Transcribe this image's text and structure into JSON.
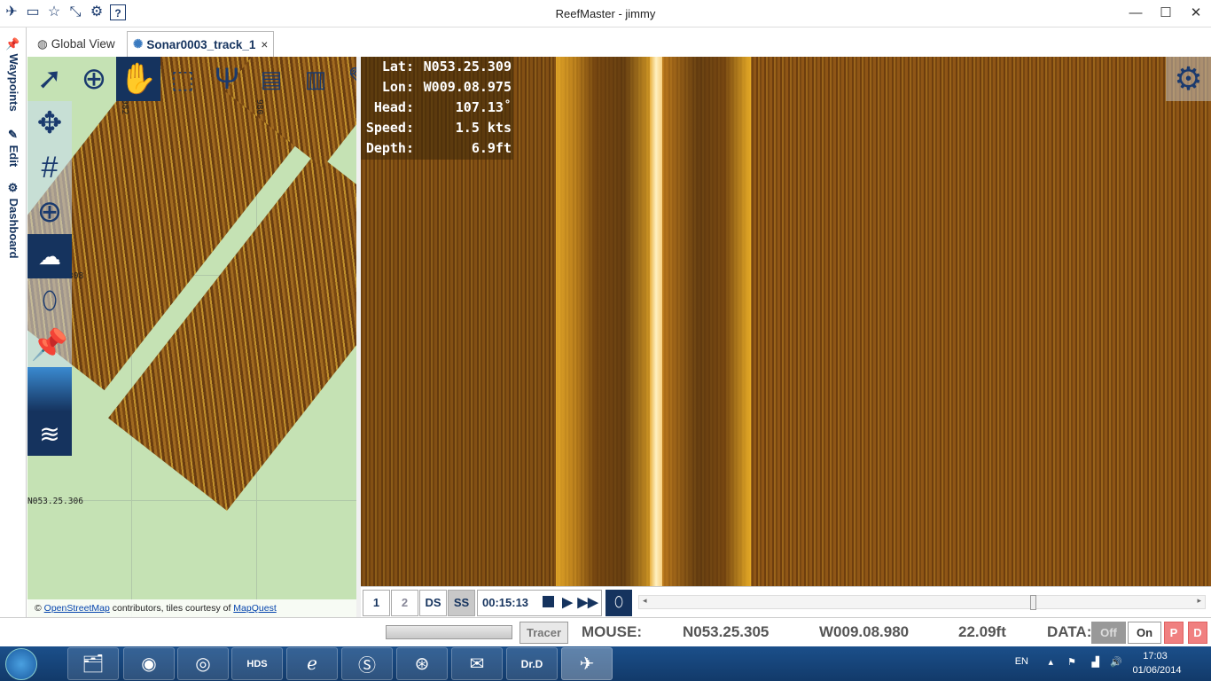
{
  "app": {
    "title": "ReefMaster - jimmy"
  },
  "window_controls": {
    "minimize": "—",
    "maximize": "☐",
    "close": "✕"
  },
  "quick_icons": [
    "reefmaster-logo-icon",
    "folder-icon",
    "star-icon",
    "collapse-icon",
    "gear-icon",
    "help-icon"
  ],
  "tabs": [
    {
      "label": "Global View",
      "icon": "globe-icon"
    },
    {
      "label": "Sonar0003_track_1",
      "icon": "spinner-icon",
      "close": "×"
    }
  ],
  "side_tabs": [
    {
      "label": "Waypoints",
      "icon": "pin-icon"
    },
    {
      "label": "Edit",
      "icon": "pencil-icon"
    },
    {
      "label": "Dashboard",
      "icon": "gear-icon"
    }
  ],
  "map": {
    "labels": {
      "lon_top1": "982",
      "lon_top2": "980",
      "lat_mid": "308",
      "lat_bottom": "N053.25.306"
    },
    "attribution": {
      "prefix": "©",
      "osm": "OpenStreetMap",
      "middle": "contributors, tiles courtesy of",
      "mq": "MapQuest"
    }
  },
  "hud": {
    "lat_label": "Lat:",
    "lat": "N053.25.309",
    "lon_label": "Lon:",
    "lon": "W009.08.975",
    "head_label": "Head:",
    "head": "107.13˚",
    "speed_label": "Speed:",
    "speed": "1.5 kts",
    "depth_label": "Depth:",
    "depth": "6.9ft"
  },
  "playback": {
    "btn1": "1",
    "btn2": "2",
    "ds": "DS",
    "ss": "SS",
    "time": "00:15:13",
    "slider_position": 0.7
  },
  "status": {
    "tracer": "Tracer",
    "mouse_label": "MOUSE:",
    "mouse_lat": "N053.25.305",
    "mouse_lon": "W009.08.980",
    "mouse_depth": "22.09ft",
    "data_label": "DATA:",
    "off": "Off",
    "on": "On",
    "p": "P",
    "d": "D"
  },
  "taskbar": {
    "lang": "EN",
    "time": "17:03",
    "date": "01/06/2014",
    "app_drd": "Dr.D"
  }
}
